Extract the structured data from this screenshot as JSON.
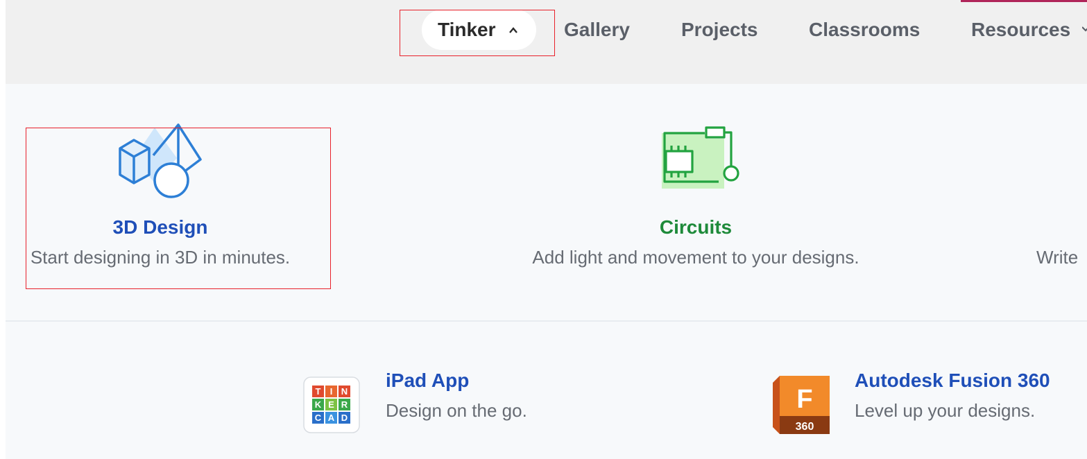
{
  "nav": {
    "items": [
      {
        "label": "Tinker",
        "active": true
      },
      {
        "label": "Gallery"
      },
      {
        "label": "Projects"
      },
      {
        "label": "Classrooms"
      },
      {
        "label": "Resources"
      }
    ],
    "chevron_up_icon": "chevron-up-icon",
    "chevron_down_icon": "chevron-down-icon"
  },
  "tinker_menu": {
    "cards": [
      {
        "title": "3D Design",
        "description": "Start designing in 3D in minutes.",
        "icon": "3d-shapes-icon",
        "color": "#1f4fb8"
      },
      {
        "title": "Circuits",
        "description": "Add light and movement to your designs.",
        "icon": "circuit-board-icon",
        "color": "#1e8a3a"
      },
      {
        "description": "Write",
        "icon": "codeblocks-icon"
      }
    ],
    "apps": [
      {
        "title": "iPad App",
        "description": "Design on the go.",
        "icon": "tinkercad-logo-icon",
        "logo_letters": [
          "T",
          "I",
          "N",
          "K",
          "E",
          "R",
          "C",
          "A",
          "D"
        ]
      },
      {
        "title": "Autodesk Fusion 360",
        "description": "Level up your designs.",
        "icon": "fusion-360-icon",
        "logo_letter": "F",
        "logo_badge": "360"
      }
    ]
  },
  "colors": {
    "accent_blue": "#1f4fb8",
    "accent_green": "#1e8a3a",
    "highlight_red": "#e8202a"
  }
}
